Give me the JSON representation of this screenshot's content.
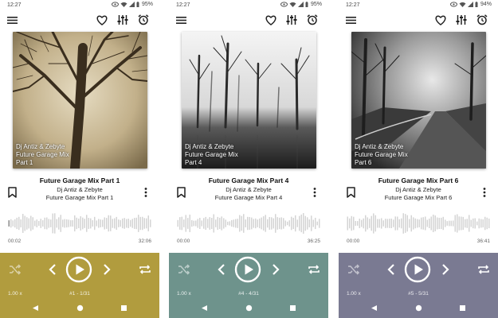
{
  "screens": [
    {
      "status": {
        "time": "12:27",
        "battery": "95%"
      },
      "overlay": {
        "artist": "Dj Antiz & Zebyte",
        "line1": "Future Garage Mix",
        "line2": "Part 1"
      },
      "track": {
        "title": "Future Garage Mix Part 1",
        "artist": "Dj Antiz & Zebyte",
        "album": "Future Garage Mix Part 1"
      },
      "time_current": "00:02",
      "time_total": "32:06",
      "speed": "1.00 x",
      "position": "#1 - 1/31",
      "progress": 0.001,
      "accent": "#b19c3e",
      "art_theme": "sepia-tree"
    },
    {
      "status": {
        "time": "12:27",
        "battery": "95%"
      },
      "overlay": {
        "artist": "Dj Antiz & Zebyte",
        "line1": "Future Garage Mix",
        "line2": "Part 4"
      },
      "track": {
        "title": "Future Garage Mix Part 4",
        "artist": "Dj Antiz & Zebyte",
        "album": "Future Garage Mix Part 4"
      },
      "time_current": "00:00",
      "time_total": "36:25",
      "speed": "1.00 x",
      "position": "#4 - 4/31",
      "progress": 0.0,
      "accent": "#6e938c",
      "art_theme": "misty-forest"
    },
    {
      "status": {
        "time": "12:27",
        "battery": "94%"
      },
      "overlay": {
        "artist": "Dj Antiz & Zebyte",
        "line1": "Future Garage Mix",
        "line2": "Part 6"
      },
      "track": {
        "title": "Future Garage Mix Part 6",
        "artist": "Dj Antiz & Zebyte",
        "album": "Future Garage Mix Part 6"
      },
      "time_current": "00:00",
      "time_total": "36:41",
      "speed": "1.00 x",
      "position": "#5 - 5/31",
      "progress": 0.0,
      "accent": "#7a7a92",
      "art_theme": "forest-road"
    }
  ],
  "icons": {
    "menu": "hamburger-menu-icon",
    "favorite": "heart-icon",
    "equalizer": "equalizer-icon",
    "sleep_timer": "alarm-clock-icon",
    "bookmark": "bookmark-icon",
    "more": "more-vertical-icon",
    "shuffle": "shuffle-icon",
    "previous": "chevron-left-icon",
    "play": "play-icon",
    "next": "chevron-right-icon",
    "repeat": "repeat-icon",
    "nav_back": "back-triangle-icon",
    "nav_home": "home-circle-icon",
    "nav_recent": "recent-square-icon"
  }
}
